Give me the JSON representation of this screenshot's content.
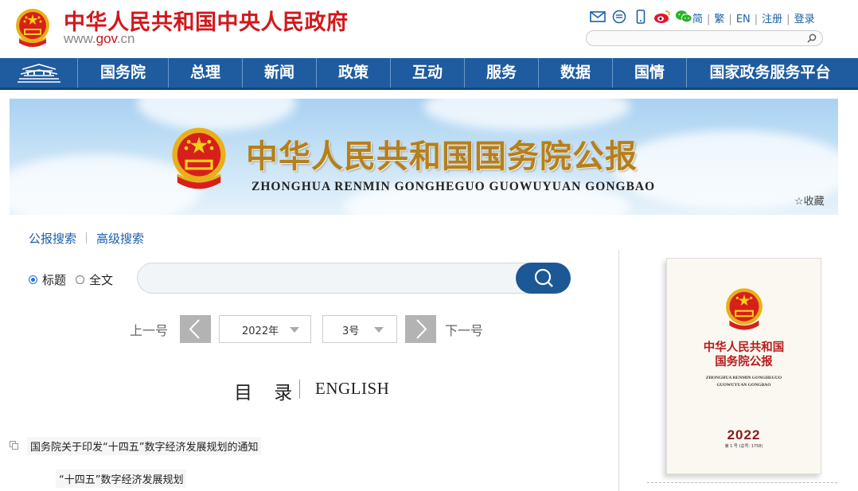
{
  "header": {
    "site_title": "中华人民共和国中央人民政府",
    "site_url_prefix": "www.",
    "site_url_domain": "gov",
    "site_url_suffix": ".cn",
    "icons": [
      "mail-icon",
      "message-icon",
      "mobile-icon",
      "weibo-icon",
      "wechat-icon"
    ],
    "links": [
      "简",
      "繁",
      "EN",
      "注册",
      "登录"
    ],
    "search_placeholder": ""
  },
  "nav": {
    "items": [
      {
        "label": "国务院"
      },
      {
        "label": "总理"
      },
      {
        "label": "新闻"
      },
      {
        "label": "政策"
      },
      {
        "label": "互动"
      },
      {
        "label": "服务"
      },
      {
        "label": "数据"
      },
      {
        "label": "国情"
      },
      {
        "label": "国家政务服务平台"
      }
    ]
  },
  "banner": {
    "title": "中华人民共和国国务院公报",
    "subtitle": "ZHONGHUA RENMIN GONGHEGUO GUOWUYUAN GONGBAO",
    "favorite_label": "收藏"
  },
  "search": {
    "tabs": [
      "公报搜索",
      "高级搜索"
    ],
    "radio_options": [
      {
        "label": "标题",
        "checked": true
      },
      {
        "label": "全文",
        "checked": false
      }
    ],
    "placeholder": ""
  },
  "issue_selector": {
    "prev_label": "上一号",
    "year": "2022年",
    "issue": "3号",
    "next_label": "下一号"
  },
  "toc": {
    "label": "目 录",
    "english": "ENGLISH"
  },
  "articles": [
    {
      "title": "国务院关于印发“十四五”数字经济发展规划的通知"
    },
    {
      "title": "“十四五”数字经济发展规划"
    }
  ],
  "cover": {
    "title_line1": "中华人民共和国",
    "title_line2": "国务院公报",
    "sub_line1": "ZHONGHUA RENMIN GONGHEGUO",
    "sub_line2": "GUOWUYUAN GONGBAO",
    "year": "2022",
    "issue_text": "第 1 号 (总号: 1758)"
  },
  "colors": {
    "brand_red": "#d2181c",
    "nav_blue": "#1e5c9f",
    "link_blue": "#1a5ea8",
    "banner_gold": "#b57f1c"
  }
}
